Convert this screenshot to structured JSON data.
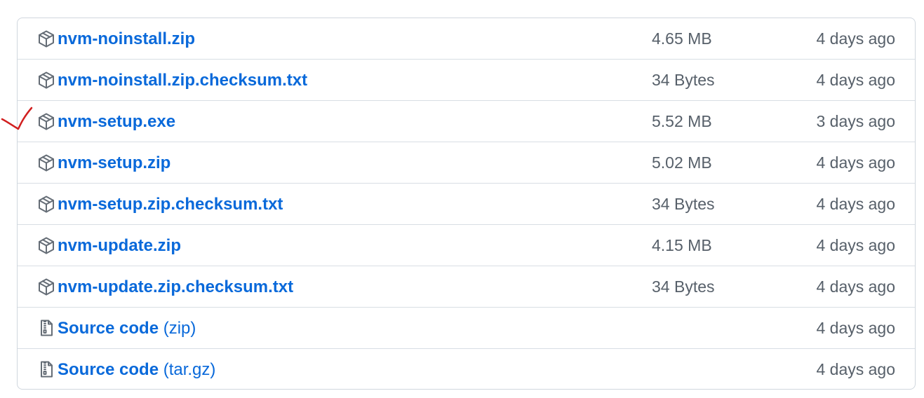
{
  "assets": [
    {
      "name": "nvm-noinstall.zip",
      "suffix": "",
      "size": "4.65 MB",
      "date": "4 days ago",
      "icon": "package-icon"
    },
    {
      "name": "nvm-noinstall.zip.checksum.txt",
      "suffix": "",
      "size": "34 Bytes",
      "date": "4 days ago",
      "icon": "package-icon"
    },
    {
      "name": "nvm-setup.exe",
      "suffix": "",
      "size": "5.52 MB",
      "date": "3 days ago",
      "icon": "package-icon"
    },
    {
      "name": "nvm-setup.zip",
      "suffix": "",
      "size": "5.02 MB",
      "date": "4 days ago",
      "icon": "package-icon"
    },
    {
      "name": "nvm-setup.zip.checksum.txt",
      "suffix": "",
      "size": "34 Bytes",
      "date": "4 days ago",
      "icon": "package-icon"
    },
    {
      "name": "nvm-update.zip",
      "suffix": "",
      "size": "4.15 MB",
      "date": "4 days ago",
      "icon": "package-icon"
    },
    {
      "name": "nvm-update.zip.checksum.txt",
      "suffix": "",
      "size": "34 Bytes",
      "date": "4 days ago",
      "icon": "package-icon"
    },
    {
      "name": "Source code",
      "suffix": " (zip)",
      "size": "",
      "date": "4 days ago",
      "icon": "file-zip-icon"
    },
    {
      "name": "Source code",
      "suffix": " (tar.gz)",
      "size": "",
      "date": "4 days ago",
      "icon": "file-zip-icon"
    }
  ],
  "colors": {
    "link": "#0969da",
    "muted": "#57606a",
    "border": "#d0d7de",
    "annotation": "#d11f1f"
  },
  "annotation": {
    "type": "handwritten-checkmark",
    "icon": "checkmark-annotation"
  }
}
